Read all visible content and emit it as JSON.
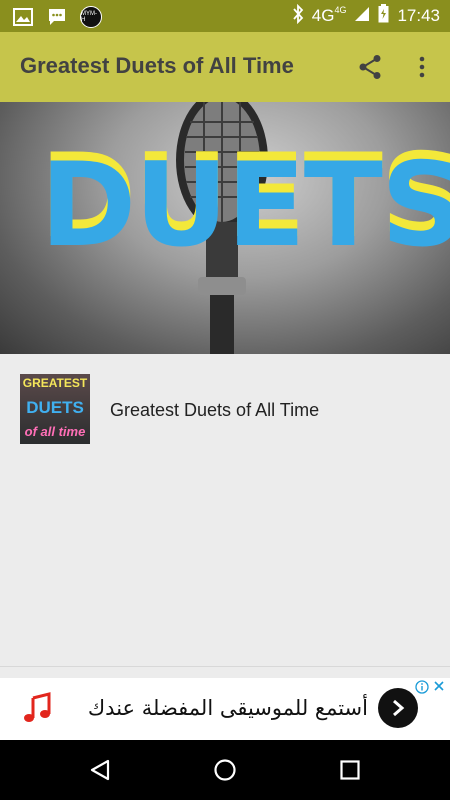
{
  "status_bar": {
    "time": "17:43",
    "network": "4G",
    "network_small": "4G",
    "notif_badge": "MYM-H",
    "icons": [
      "image-icon",
      "chat-icon",
      "bluetooth-icon",
      "signal-icon",
      "battery-icon"
    ]
  },
  "app_bar": {
    "title": "Greatest Duets of All Time",
    "icons": [
      "share-icon",
      "more-vert-icon"
    ]
  },
  "banner": {
    "word": "DUETS"
  },
  "list": {
    "items": [
      {
        "title": "Greatest Duets of All Time",
        "thumb_line1": "GREATEST",
        "thumb_line2": "DUETS",
        "thumb_line3": "of all time"
      }
    ]
  },
  "ad": {
    "text": "أستمع للموسيقى المفضلة عندك",
    "icons": [
      "music-note-icon",
      "chevron-right-icon",
      "info-icon",
      "close-icon"
    ]
  },
  "nav_bar": {
    "icons": [
      "back-icon",
      "home-icon",
      "recent-apps-icon"
    ]
  },
  "colors": {
    "status_bar": "#8a8f1e",
    "app_bar": "#c6c54b",
    "title_text": "#424242",
    "duets_blue": "#36a8e6",
    "duets_yellow": "#f3e83a",
    "music_red": "#e2261d"
  }
}
